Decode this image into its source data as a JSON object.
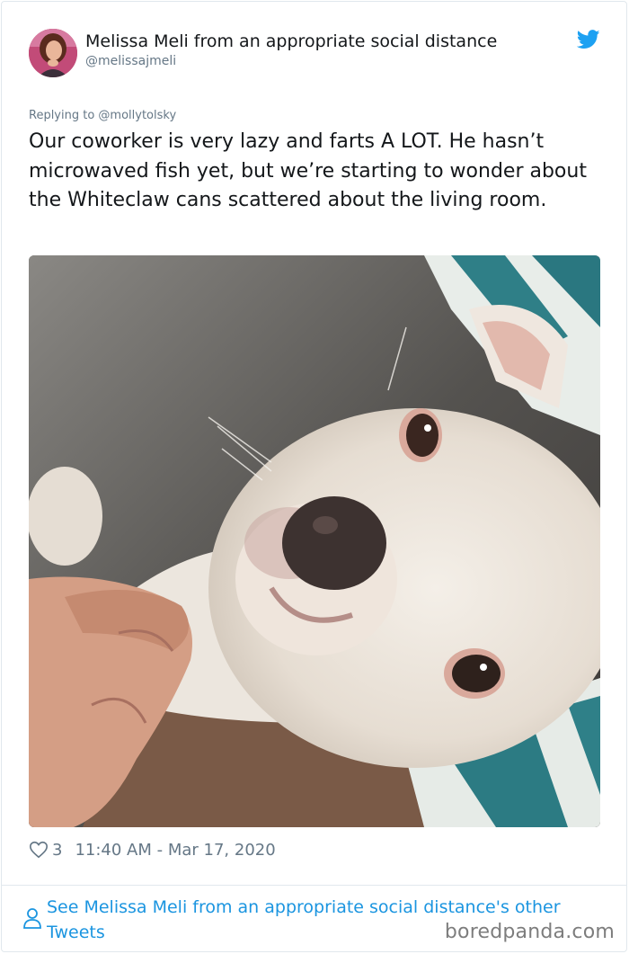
{
  "author": {
    "display_name": "Melissa Meli from an appropriate social distance",
    "handle": "@melissajmeli",
    "avatar": "avatar-photo"
  },
  "icons": {
    "brand": "twitter-bird-icon",
    "like": "heart-outline-icon",
    "profile": "person-outline-icon"
  },
  "colors": {
    "twitter_blue": "#1da1f2",
    "link_blue": "#1b95e0",
    "secondary_text": "#657786",
    "primary_text": "#14171a"
  },
  "tweet": {
    "replying_to": "Replying to @mollytolsky",
    "text": "Our coworker is very lazy and farts A LOT. He hasn’t microwaved fish yet, but we’re starting to wonder about the Whiteclaw cans scattered about the living room.",
    "photo": "photo-white-dog-lying-on-couch",
    "like_count": "3",
    "timestamp": "11:40 AM - Mar 17, 2020"
  },
  "footer": {
    "other_tweets_link": "See Melissa Meli from an appropriate social distance's other Tweets"
  },
  "watermark": "boredpanda.com"
}
